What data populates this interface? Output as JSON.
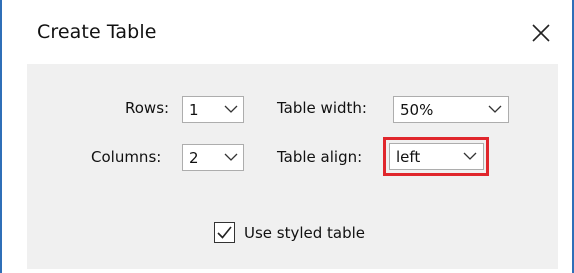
{
  "dialog": {
    "title": "Create Table",
    "close_icon": "close-icon",
    "accent_border": "#2f6fb8",
    "highlight_color": "#e0262c"
  },
  "form": {
    "rows_label": "Rows:",
    "rows_value": "1",
    "columns_label": "Columns:",
    "columns_value": "2",
    "table_width_label": "Table width:",
    "table_width_value": "50%",
    "table_align_label": "Table align:",
    "table_align_value": "left",
    "styled_table_label": "Use styled table",
    "styled_table_checked": true
  }
}
